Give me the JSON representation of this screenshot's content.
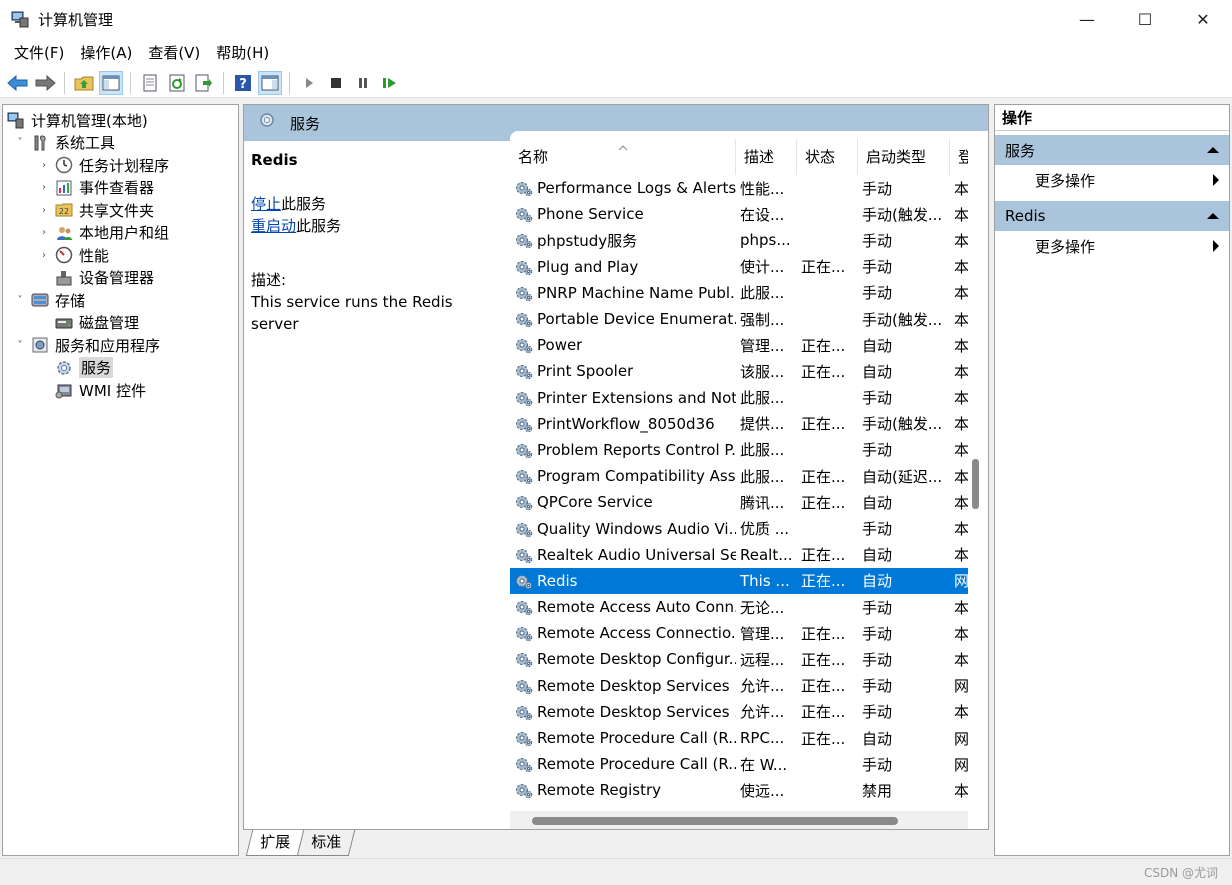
{
  "window": {
    "title": "计算机管理",
    "minimize": "—",
    "maximize": "☐",
    "close": "✕"
  },
  "menu": [
    "文件(F)",
    "操作(A)",
    "查看(V)",
    "帮助(H)"
  ],
  "toolbar_icons": [
    "back-icon",
    "forward-icon",
    "up-folder-icon",
    "show-hide-tree-icon",
    "properties-icon",
    "refresh-icon",
    "export-list-icon",
    "help-icon",
    "show-hide-action-icon",
    "start-service-icon",
    "stop-service-icon",
    "pause-service-icon",
    "restart-service-icon"
  ],
  "tree": [
    {
      "label": "计算机管理(本地)",
      "level": 0,
      "toggle": "",
      "icon": "computer-management-icon"
    },
    {
      "label": "系统工具",
      "level": 1,
      "toggle": "˅",
      "icon": "system-tools-icon"
    },
    {
      "label": "任务计划程序",
      "level": 2,
      "toggle": "›",
      "icon": "task-scheduler-icon"
    },
    {
      "label": "事件查看器",
      "level": 2,
      "toggle": "›",
      "icon": "event-viewer-icon"
    },
    {
      "label": "共享文件夹",
      "level": 2,
      "toggle": "›",
      "icon": "shared-folders-icon"
    },
    {
      "label": "本地用户和组",
      "level": 2,
      "toggle": "›",
      "icon": "local-users-icon"
    },
    {
      "label": "性能",
      "level": 2,
      "toggle": "›",
      "icon": "performance-icon"
    },
    {
      "label": "设备管理器",
      "level": 2,
      "toggle": "",
      "icon": "device-manager-icon"
    },
    {
      "label": "存储",
      "level": 1,
      "toggle": "˅",
      "icon": "storage-icon"
    },
    {
      "label": "磁盘管理",
      "level": 2,
      "toggle": "",
      "icon": "disk-management-icon"
    },
    {
      "label": "服务和应用程序",
      "level": 1,
      "toggle": "˅",
      "icon": "services-apps-icon"
    },
    {
      "label": "服务",
      "level": 2,
      "toggle": "",
      "icon": "services-icon",
      "selected": true
    },
    {
      "label": "WMI 控件",
      "level": 2,
      "toggle": "",
      "icon": "wmi-control-icon"
    }
  ],
  "middle": {
    "header_title": "服务",
    "detail": {
      "service_name": "Redis",
      "stop_link": "停止",
      "stop_suffix": "此服务",
      "restart_link": "重启动",
      "restart_suffix": "此服务",
      "desc_label": "描述:",
      "desc_text": "This service runs the Redis server"
    },
    "columns": [
      "名称",
      "描述",
      "状态",
      "启动类型",
      "登"
    ],
    "rows": [
      {
        "name": "Performance Logs & Alerts",
        "desc": "性能...",
        "status": "",
        "startup": "手动",
        "logon": "本"
      },
      {
        "name": "Phone Service",
        "desc": "在设...",
        "status": "",
        "startup": "手动(触发...",
        "logon": "本"
      },
      {
        "name": "phpstudy服务",
        "desc": "phps...",
        "status": "",
        "startup": "手动",
        "logon": "本"
      },
      {
        "name": "Plug and Play",
        "desc": "使计...",
        "status": "正在...",
        "startup": "手动",
        "logon": "本"
      },
      {
        "name": "PNRP Machine Name Publ...",
        "desc": "此服...",
        "status": "",
        "startup": "手动",
        "logon": "本"
      },
      {
        "name": "Portable Device Enumerat...",
        "desc": "强制...",
        "status": "",
        "startup": "手动(触发...",
        "logon": "本"
      },
      {
        "name": "Power",
        "desc": "管理...",
        "status": "正在...",
        "startup": "自动",
        "logon": "本"
      },
      {
        "name": "Print Spooler",
        "desc": "该服...",
        "status": "正在...",
        "startup": "自动",
        "logon": "本"
      },
      {
        "name": "Printer Extensions and Noti...",
        "desc": "此服...",
        "status": "",
        "startup": "手动",
        "logon": "本"
      },
      {
        "name": "PrintWorkflow_8050d36",
        "desc": "提供...",
        "status": "正在...",
        "startup": "手动(触发...",
        "logon": "本"
      },
      {
        "name": "Problem Reports Control P...",
        "desc": "此服...",
        "status": "",
        "startup": "手动",
        "logon": "本"
      },
      {
        "name": "Program Compatibility Assi...",
        "desc": "此服...",
        "status": "正在...",
        "startup": "自动(延迟...",
        "logon": "本"
      },
      {
        "name": "QPCore Service",
        "desc": "腾讯...",
        "status": "正在...",
        "startup": "自动",
        "logon": "本"
      },
      {
        "name": "Quality Windows Audio Vi...",
        "desc": "优质 ...",
        "status": "",
        "startup": "手动",
        "logon": "本"
      },
      {
        "name": "Realtek Audio Universal Se...",
        "desc": "Realt...",
        "status": "正在...",
        "startup": "自动",
        "logon": "本"
      },
      {
        "name": "Redis",
        "desc": "This ...",
        "status": "正在...",
        "startup": "自动",
        "logon": "网",
        "selected": true
      },
      {
        "name": "Remote Access Auto Conn...",
        "desc": "无论...",
        "status": "",
        "startup": "手动",
        "logon": "本"
      },
      {
        "name": "Remote Access Connectio...",
        "desc": "管理...",
        "status": "正在...",
        "startup": "手动",
        "logon": "本"
      },
      {
        "name": "Remote Desktop Configur...",
        "desc": "远程...",
        "status": "正在...",
        "startup": "手动",
        "logon": "本"
      },
      {
        "name": "Remote Desktop Services",
        "desc": "允许...",
        "status": "正在...",
        "startup": "手动",
        "logon": "网"
      },
      {
        "name": "Remote Desktop Services ...",
        "desc": "允许...",
        "status": "正在...",
        "startup": "手动",
        "logon": "本"
      },
      {
        "name": "Remote Procedure Call (R...",
        "desc": "RPC...",
        "status": "正在...",
        "startup": "自动",
        "logon": "网"
      },
      {
        "name": "Remote Procedure Call (R...",
        "desc": "在 W...",
        "status": "",
        "startup": "手动",
        "logon": "网"
      },
      {
        "name": "Remote Registry",
        "desc": "使远...",
        "status": "",
        "startup": "禁用",
        "logon": "本"
      }
    ]
  },
  "tabs": [
    "扩展",
    "标准"
  ],
  "actions": {
    "title": "操作",
    "sections": [
      {
        "label": "服务",
        "item": "更多操作"
      },
      {
        "label": "Redis",
        "item": "更多操作"
      }
    ]
  },
  "statusbar": {
    "watermark": "CSDN @尤词"
  },
  "colors": {
    "selection": "#0078d7",
    "header_band": "#aac4dc",
    "link": "#0645ad"
  }
}
